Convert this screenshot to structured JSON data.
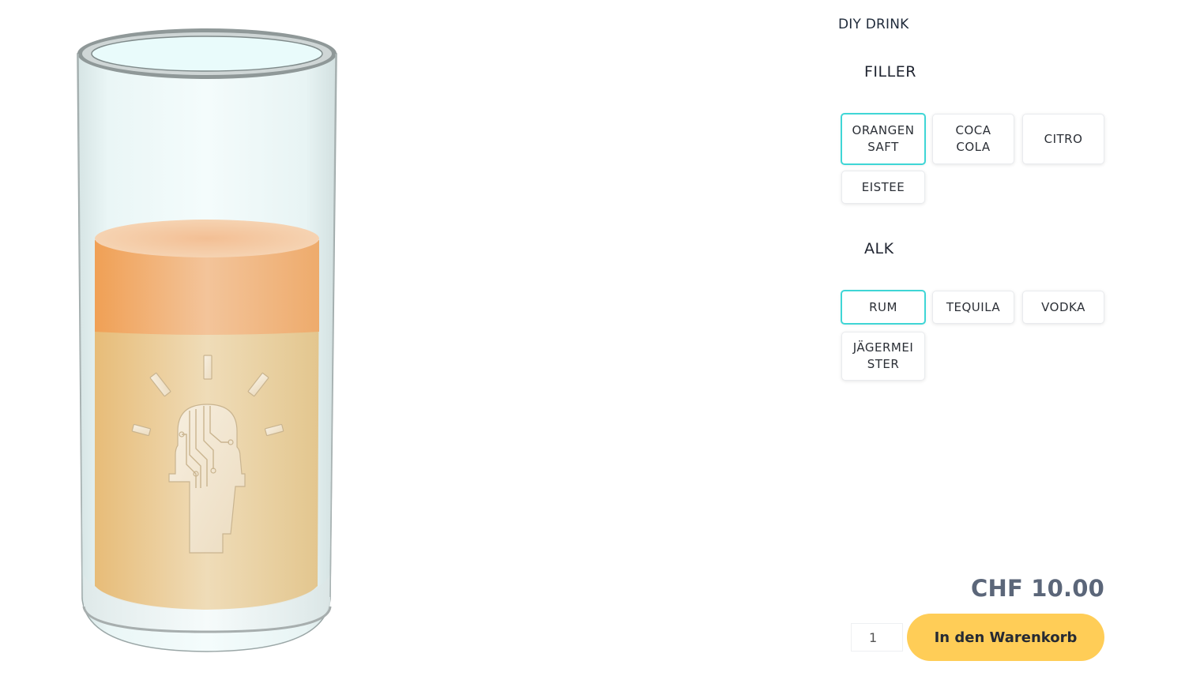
{
  "product": {
    "title": "DIY DRINK"
  },
  "glass": {
    "liquid_color": "#e8c488",
    "foam_color": "#f0a860",
    "emblem": "circuit-head-emblem"
  },
  "filler": {
    "title": "FILLER",
    "options": [
      {
        "label": "ORANGEN\nSAFT",
        "selected": true
      },
      {
        "label": "COCA\nCOLA",
        "selected": false
      },
      {
        "label": "CITRO",
        "selected": false
      },
      {
        "label": "EISTEE",
        "selected": false
      }
    ]
  },
  "alk": {
    "title": "ALK",
    "options": [
      {
        "label": "RUM",
        "selected": true
      },
      {
        "label": "TEQUILA",
        "selected": false
      },
      {
        "label": "VODKA",
        "selected": false
      },
      {
        "label": "JÄGERMEI\nSTER",
        "selected": false
      }
    ]
  },
  "purchase": {
    "price": "CHF 10.00",
    "quantity": "1",
    "add_to_cart_label": "In den Warenkorb"
  },
  "colors": {
    "accent_selected": "#3fd6d6",
    "cart_button": "#ffcd57",
    "price_text": "#5b6679"
  }
}
